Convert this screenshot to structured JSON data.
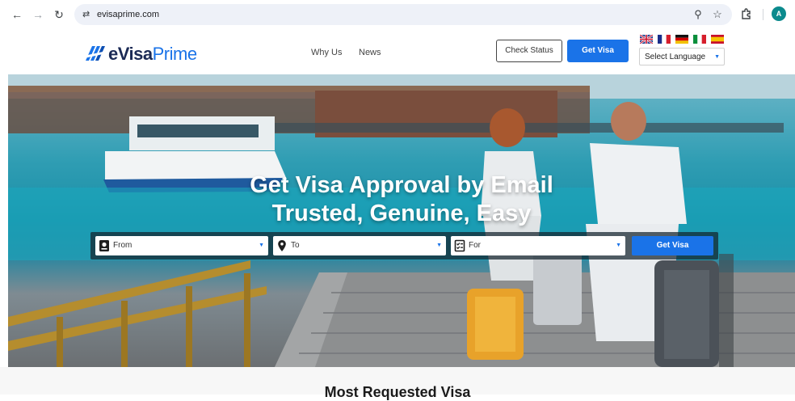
{
  "browser": {
    "url": "evisaprime.com",
    "profile_initial": "A"
  },
  "header": {
    "logo_text_a": "eVisa",
    "logo_text_b": "Prime",
    "nav": [
      "Why Us",
      "News"
    ],
    "check_status_label": "Check Status",
    "get_visa_label": "Get Visa",
    "language_select": "Select Language",
    "flags": [
      "uk-flag",
      "france-flag",
      "germany-flag",
      "italy-flag",
      "spain-flag"
    ]
  },
  "hero": {
    "title_line1": "Get Visa Approval by Email",
    "title_line2": "Trusted, Genuine, Easy",
    "search": {
      "from_label": "From",
      "to_label": "To",
      "for_label": "For",
      "button_label": "Get Visa"
    }
  },
  "section": {
    "title": "Most Requested Visa"
  },
  "colors": {
    "brand_blue": "#1a73e8",
    "brand_navy": "#1b2a55"
  }
}
